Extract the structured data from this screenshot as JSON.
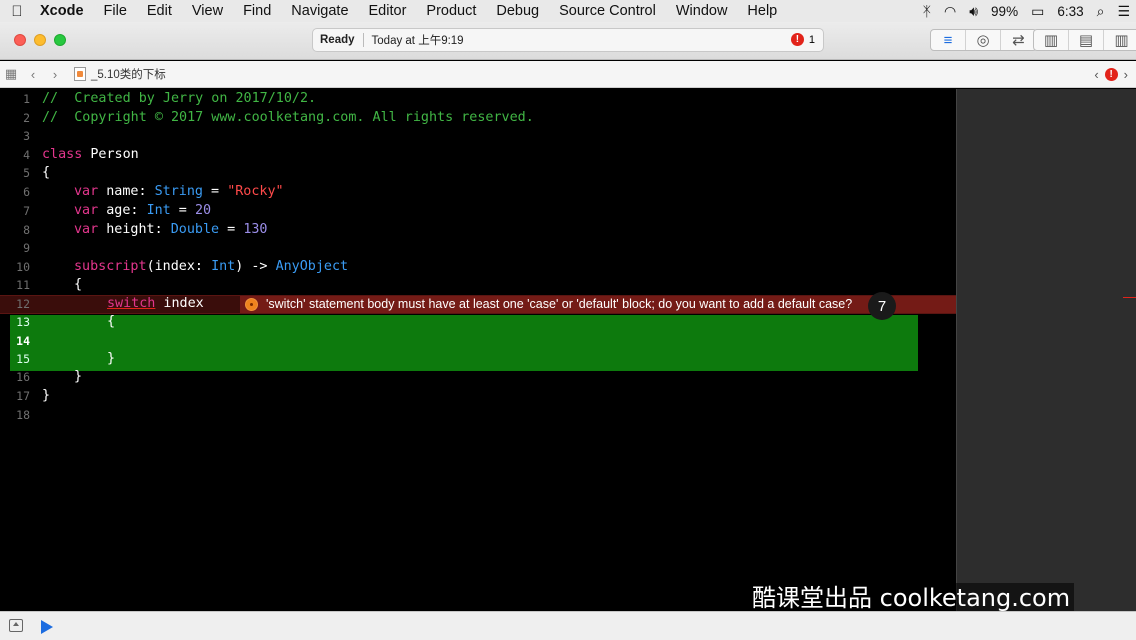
{
  "menubar": {
    "apple": "",
    "items": [
      "Xcode",
      "File",
      "Edit",
      "View",
      "Find",
      "Navigate",
      "Editor",
      "Product",
      "Debug",
      "Source Control",
      "Window",
      "Help"
    ],
    "battery": "99%",
    "time": "6:33"
  },
  "activity": {
    "status": "Ready",
    "timestamp": "Today at 上午9:19",
    "error_count": "1"
  },
  "jumpbar": {
    "file": "_5.10类的下标"
  },
  "editor": {
    "lines": [
      {
        "n": "1"
      },
      {
        "n": "2"
      },
      {
        "n": "3"
      },
      {
        "n": "4"
      },
      {
        "n": "5"
      },
      {
        "n": "6"
      },
      {
        "n": "7"
      },
      {
        "n": "8"
      },
      {
        "n": "9"
      },
      {
        "n": "10"
      },
      {
        "n": "11"
      },
      {
        "n": "12"
      },
      {
        "n": "13"
      },
      {
        "n": "14"
      },
      {
        "n": "15"
      },
      {
        "n": "16"
      },
      {
        "n": "17"
      },
      {
        "n": "18"
      }
    ],
    "code": {
      "l1": "//  Created by Jerry on 2017/10/2.",
      "l2": "//  Copyright © 2017 www.coolketang.com. All rights reserved.",
      "l4_kw": "class",
      "l4_name": " Person",
      "l5": "{",
      "var": "var",
      "l6_a": " name: ",
      "l6_type": "String",
      "l6_b": " = ",
      "l6_val": "\"Rocky\"",
      "l7_a": " age: ",
      "l7_type": "Int",
      "l7_b": " = ",
      "l7_val": "20",
      "l8_a": " height: ",
      "l8_type": "Double",
      "l8_b": " = ",
      "l8_val": "130",
      "l10_kw": "subscript",
      "l10_a": "(index: ",
      "l10_type": "Int",
      "l10_b": ") -> ",
      "l10_ret": "AnyObject",
      "l11": "{",
      "l12_kw": "switch",
      "l12_b": " index",
      "l13": "{",
      "l15": "}",
      "l16": "}",
      "l17": "}"
    },
    "error_message": "'switch' statement body must have at least one 'case' or 'default' block; do you want to add a default case?"
  },
  "overlay": {
    "cursor_badge": "7",
    "watermark": "酷课堂出品 coolketang.com"
  }
}
